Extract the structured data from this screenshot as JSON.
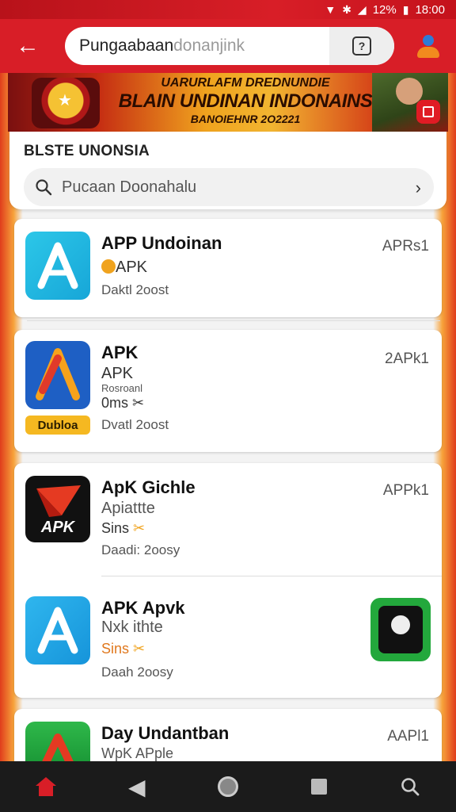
{
  "status_bar": {
    "battery": "12%",
    "time": "18:00"
  },
  "header": {
    "search_value": "Pungaabaan",
    "search_placeholder": "donanjink"
  },
  "banner": {
    "line1": "UARURLAFM DREDNUNDIE",
    "line2": "BLAIN UNDINAN INDONAINS",
    "line3": "BANOIEHNR 2O2221"
  },
  "section": {
    "title": "BLSTE UNONSIA",
    "search_text": "Pucaan Doonahalu"
  },
  "apps": [
    {
      "name": "APP Undoinan",
      "line2": "APK",
      "line3": "Daktl 2oost",
      "right": "APRs1"
    },
    {
      "name": "APK",
      "line2": "APK",
      "small": "Rosroanl",
      "line3": "0ms",
      "line4": "Dvatl 2oost",
      "tag": "Dubloa",
      "right": "2APk1"
    },
    {
      "name": "ApK Gichle",
      "line2": "Apiattte",
      "line3": "Sins",
      "line4": "Daadi: 2oosy",
      "right": "APPk1",
      "icon_text": "APK"
    },
    {
      "name": "APK Apvk",
      "line2": "Nxk ithte",
      "line3": "Sins",
      "line4": "Daah 2oosy"
    },
    {
      "name": "Day Undantban",
      "line2": "WpK APple",
      "right": "AAPl1"
    }
  ],
  "colors": {
    "brand_red": "#d81e27",
    "accent_orange": "#f0a31e",
    "nav_bg": "#1b1b1b"
  },
  "icons": [
    "back-arrow-icon",
    "help-icon",
    "account-icon",
    "search-icon",
    "chevron-right-icon",
    "home-icon",
    "back-nav-icon",
    "circle-home-icon",
    "recents-icon",
    "search-nav-icon"
  ]
}
